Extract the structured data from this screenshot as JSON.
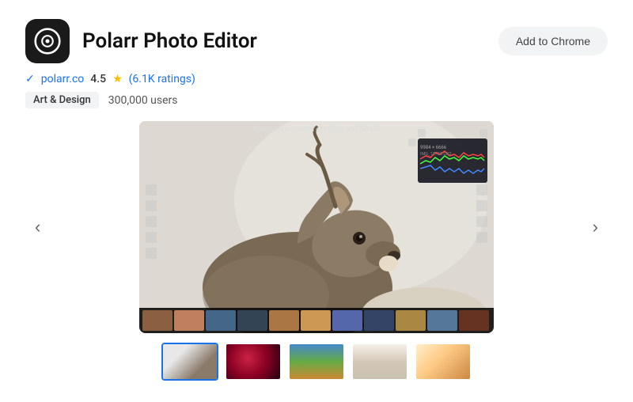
{
  "app": {
    "icon_label": "Polarr Photo Editor icon",
    "title": "Polarr Photo Editor",
    "add_button_label": "Add to Chrome"
  },
  "meta": {
    "website": "polarr.co",
    "rating_number": "4.5",
    "rating_star": "★",
    "ratings_count": "(6.1K ratings)",
    "category": "Art & Design",
    "users": "300,000 users"
  },
  "carousel": {
    "scene_title": "Spectacular control of colors and details",
    "left_arrow": "‹",
    "right_arrow": "›"
  },
  "thumbnails": [
    {
      "id": 1,
      "active": true
    },
    {
      "id": 2,
      "active": false
    },
    {
      "id": 3,
      "active": false
    },
    {
      "id": 4,
      "active": false
    },
    {
      "id": 5,
      "active": false
    }
  ],
  "filmstrip_colors": [
    "#8a6040",
    "#c08060",
    "#446688",
    "#334455",
    "#aa7744",
    "#cc9955",
    "#5566aa",
    "#334466",
    "#aa8844",
    "#557799",
    "#663322",
    "#887755",
    "#446699",
    "#334466",
    "#cc8833"
  ]
}
